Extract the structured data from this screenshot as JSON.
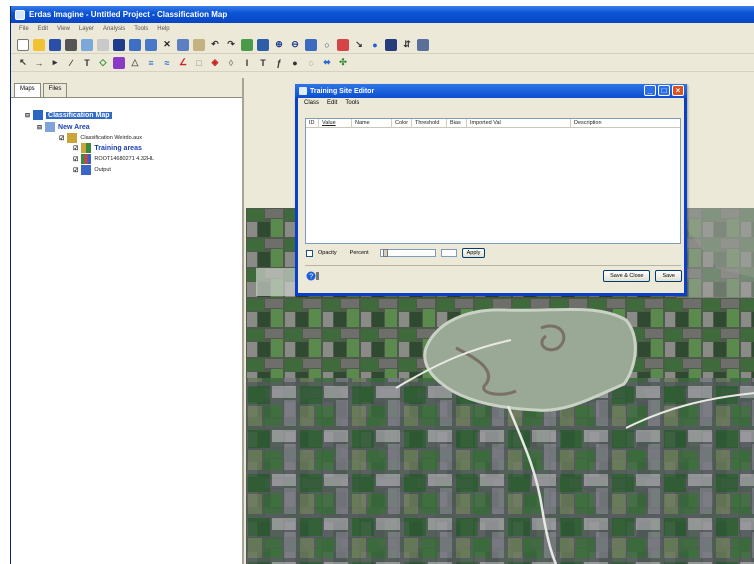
{
  "app": {
    "title": "Erdas Imagine - Untitled Project - Classification Map"
  },
  "menubar": [
    "File",
    "Edit",
    "View",
    "Layer",
    "Analysis",
    "Tools",
    "Help"
  ],
  "left_pane": {
    "tabs": [
      "Maps",
      "Files"
    ],
    "tree": {
      "root": "Classification Map",
      "area": "New Area",
      "layer_file": "Classification Weirdo.aux",
      "training_areas": "Training areas",
      "image": "ROOT14680271 4.32HL",
      "output": "Output"
    }
  },
  "dialog": {
    "title": "Training Site Editor",
    "menu": [
      "Class",
      "Edit",
      "Tools"
    ],
    "columns": [
      "ID",
      "Value",
      "Name",
      "Color",
      "Threshold",
      "Bias",
      "Imported Val",
      "Description"
    ],
    "opacity_label": "Opacity",
    "percent_label": "Percent",
    "apply_label": "Apply",
    "save_close_label": "Save & Close",
    "save_label": "Save"
  },
  "colors": {
    "titlebar": "#0b54d6",
    "highlight": "#316ac5",
    "close_button": "#d9521f"
  }
}
